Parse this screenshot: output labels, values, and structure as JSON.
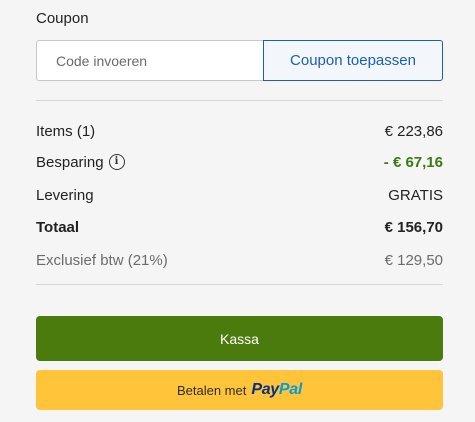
{
  "coupon": {
    "label": "Coupon",
    "placeholder": "Code invoeren",
    "button_label": "Coupon toepassen"
  },
  "summary": {
    "items_label": "Items (1)",
    "items_value": "€ 223,86",
    "savings_label": "Besparing",
    "savings_value": "- € 67,16",
    "delivery_label": "Levering",
    "delivery_value": "GRATIS",
    "total_label": "Totaal",
    "total_value": "€ 156,70",
    "excl_vat_label": "Exclusief btw (21%)",
    "excl_vat_value": "€ 129,50"
  },
  "actions": {
    "checkout_label": "Kassa",
    "paypal_prefix": "Betalen met",
    "paypal_logo_part1": "Pay",
    "paypal_logo_part2": "Pal"
  },
  "icons": {
    "info": "info-circle-icon"
  },
  "colors": {
    "savings": "#3b7a11",
    "checkout_button": "#4b7b0c",
    "paypal_button": "#ffc439",
    "coupon_button_accent": "#1a5fb4",
    "paypal_dark": "#003087",
    "paypal_light": "#009cde"
  }
}
